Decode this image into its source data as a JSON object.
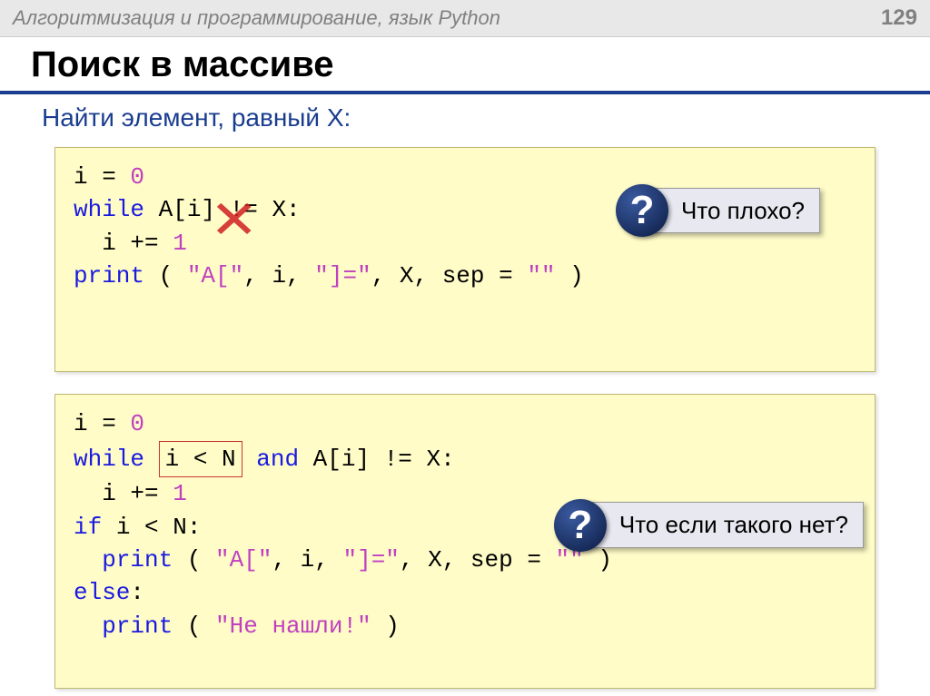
{
  "header": {
    "title": "Алгоритмизация и программирование, язык Python",
    "page": "129"
  },
  "main_title": "Поиск в массиве",
  "sub_title": "Найти элемент, равный X:",
  "code1": {
    "l1a": "i = ",
    "l1b": "0",
    "l2a": "while",
    "l2b": " A[i] != X:",
    "l3a": "  i += ",
    "l3b": "1",
    "l4a": "print",
    "l4b": " ( ",
    "l4c": "\"A[\"",
    "l4d": ", i, ",
    "l4e": "\"]=\"",
    "l4f": ", X, sep = ",
    "l4g": "\"\"",
    "l4h": " )"
  },
  "callout1": "Что плохо?",
  "code2": {
    "l1a": "i = ",
    "l1b": "0",
    "l2a": "while",
    "l2b": " ",
    "l2box": "i < N",
    "l2c": " ",
    "l2d": "and",
    "l2e": " A[i] != X:",
    "l3a": "  i += ",
    "l3b": "1",
    "l4a": "if",
    "l4b": " i < N:",
    "l5a": "  ",
    "l5b": "print",
    "l5c": " ( ",
    "l5d": "\"A[\"",
    "l5e": ", i, ",
    "l5f": "\"]=\"",
    "l5g": ", X, sep = ",
    "l5h": "\"\"",
    "l5i": " )",
    "l6a": "else",
    "l6b": ":",
    "l7a": "  ",
    "l7b": "print",
    "l7c": " ( ",
    "l7d": "\"Не нашли!\"",
    "l7e": " )"
  },
  "callout2": "Что если такого нет?"
}
